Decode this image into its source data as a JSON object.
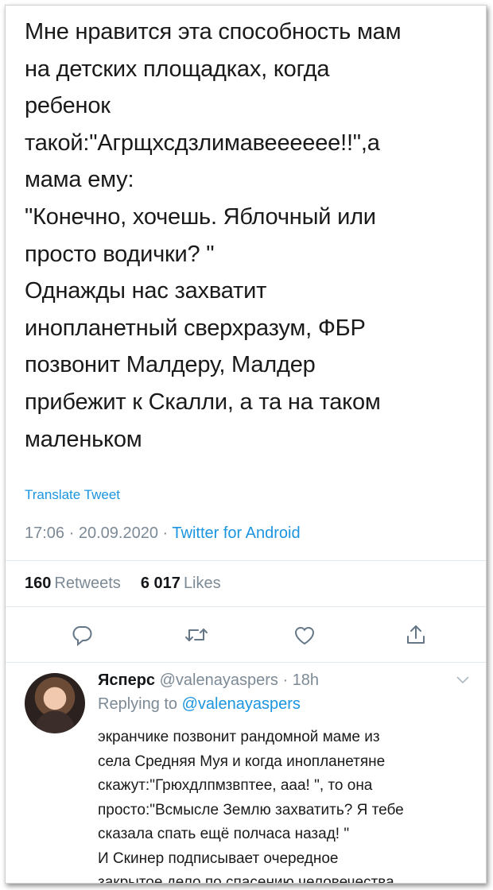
{
  "tweet": {
    "lines": [
      "Мне нравится эта способность мам",
      "на детских площадках, когда",
      "ребенок",
      "такой:\"Агрщхсдзлимавееееее!!\",а",
      "мама ему:",
      "\"Конечно, хочешь. Яблочный или",
      "просто водички? \"",
      "Однажды нас захватит",
      "инопланетный сверхразум, ФБР",
      "позвонит Малдеру, Малдер",
      "прибежит к Скалли, а та на таком",
      "маленьком"
    ],
    "translate_label": "Translate Tweet",
    "time": "17:06",
    "date": "20.09.2020",
    "separator": "·",
    "source": "Twitter for Android",
    "retweets_count": "160",
    "retweets_label": "Retweets",
    "likes_count": "6 017",
    "likes_label": "Likes"
  },
  "actions": {
    "reply_icon": "comment-icon",
    "retweet_icon": "retweet-icon",
    "like_icon": "heart-icon",
    "share_icon": "share-icon"
  },
  "reply": {
    "name": "Ясперс",
    "handle": "@valenayaspers",
    "time": "· 18h",
    "replying_label": "Replying to",
    "replying_handle": "@valenayaspers",
    "lines": [
      "экранчике позвонит рандомной маме из",
      "села Средняя Муя и когда инопланетяне",
      "скажут:\"Грюхдлпмзвптее, ааа! \", то она",
      "просто:\"Всмысле Землю захватить? Я тебе",
      "сказала спать ещё полчаса назад! \"",
      "И Скинер подписывает очередное",
      "закрытое дело по спасению человечества."
    ]
  },
  "colors": {
    "link": "#1b95e0",
    "muted": "#7c8a96",
    "text": "#14171a",
    "icon": "#657786"
  }
}
